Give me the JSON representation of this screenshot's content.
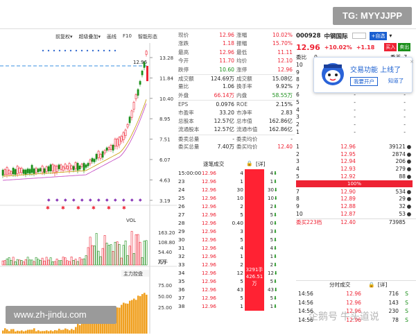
{
  "watermark_top": "TG: MYYJJPP",
  "watermark_bottom": "www.zh-jindu.com",
  "watermark_right": "企鹅号 牛头道说",
  "toolbar": {
    "items": [
      "前复权▾",
      "超级叠加▾",
      "画线",
      "F10",
      "智能形态"
    ]
  },
  "price_axis": [
    "13.28",
    "11.84",
    "10.40",
    "8.95",
    "7.51",
    "6.07",
    "4.63",
    "3.19"
  ],
  "current_price_tag": "12.96",
  "vol_label": "VOL",
  "vol_axis": [
    "163.20",
    "108.80",
    "54.40",
    "万手"
  ],
  "vol_unit": "X万",
  "fund_label": "主力控盘",
  "fund_axis": [
    "75.00",
    "50.00",
    "25.00"
  ],
  "quote": {
    "rows": [
      [
        "现价",
        "12.96",
        "涨幅",
        "10.02%"
      ],
      [
        "涨跌",
        "1.18",
        "振幅",
        "15.70%"
      ],
      [
        "最高",
        "12.96",
        "最低",
        "11.11"
      ],
      [
        "今开",
        "11.70",
        "均价",
        "12.10"
      ],
      [
        "跌停",
        "10.60",
        "涨停",
        "12.96"
      ],
      [
        "成交额",
        "124.69万",
        "成交额",
        "15.08亿"
      ],
      [
        "量比",
        "1.06",
        "换手率",
        "9.92%"
      ],
      [
        "外盘",
        "66.14万",
        "内盘",
        "58.55万"
      ],
      [
        "EPS",
        "0.0976",
        "ROE",
        "2.15%"
      ],
      [
        "市盈率",
        "33.20",
        "市净率",
        "2.83"
      ],
      [
        "总股本",
        "12.57亿",
        "总市值",
        "162.86亿"
      ],
      [
        "流通股本",
        "12.57亿",
        "流通市值",
        "162.86亿"
      ],
      [
        "委卖总量",
        "-",
        "委卖均价",
        "-"
      ],
      [
        "委买总量",
        "7.40万",
        "委买均价",
        "12.40"
      ]
    ]
  },
  "ticks_header": {
    "title": "逐笔成交",
    "lock": "🔒",
    "detail": "[详]"
  },
  "ticks": [
    [
      "15:00:00",
      "12.96",
      "4 S",
      "4"
    ],
    [
      "23",
      "12.96",
      "1 S",
      "1"
    ],
    [
      "24",
      "12.96",
      "30 S",
      "30"
    ],
    [
      "25",
      "12.96",
      "10 S",
      "10"
    ],
    [
      "26",
      "12.96",
      "2 S",
      "2"
    ],
    [
      "27",
      "12.96",
      "5 S",
      "5"
    ],
    [
      "28",
      "12.96",
      "0.40 S",
      "0"
    ],
    [
      "29",
      "12.96",
      "3 S",
      "3"
    ],
    [
      "30",
      "12.96",
      "5 S",
      "5"
    ],
    [
      "31",
      "12.96",
      "4 S",
      "4"
    ],
    [
      "32",
      "12.96",
      "1 S",
      "1"
    ],
    [
      "33",
      "12.96",
      "2 S",
      "2"
    ],
    [
      "34",
      "12.96",
      "12 S",
      "12"
    ],
    [
      "35",
      "12.96",
      "5 S",
      "5"
    ],
    [
      "36",
      "12.96",
      "43 S",
      "43"
    ],
    [
      "37",
      "12.96",
      "5 S",
      "5"
    ],
    [
      "38",
      "12.96",
      "1 S",
      "1"
    ]
  ],
  "ticks_summary": {
    "hands": "3291手",
    "amount": "426.51万"
  },
  "stock": {
    "code": "000928",
    "name": "中钢国际",
    "price": "12.96",
    "change_pct": "+10.02%",
    "change": "+1.18",
    "add_watch": "+自选",
    "buy": "买入",
    "sell": "卖出",
    "weibi_label": "委比",
    "weibi_value": "0",
    "weicha_label": "委差",
    "weicha_value": "7"
  },
  "order_book": {
    "sell_levels": [
      "10",
      "9",
      "8",
      "7",
      "6",
      "5",
      "4",
      "3",
      "2",
      "1"
    ],
    "pct_bar": "100%",
    "buy": [
      [
        "1",
        "12.96",
        "39121"
      ],
      [
        "2",
        "12.95",
        "2874"
      ],
      [
        "3",
        "12.94",
        "206"
      ],
      [
        "4",
        "12.93",
        "279"
      ],
      [
        "5",
        "12.92",
        "88"
      ],
      [
        "6",
        "12.91",
        "106"
      ],
      [
        "7",
        "12.90",
        "534"
      ],
      [
        "8",
        "12.89",
        "29"
      ],
      [
        "9",
        "12.88",
        "32"
      ],
      [
        "10",
        "12.87",
        "53"
      ]
    ],
    "buy_total_label": "委买223档",
    "buy_total_price": "12.40",
    "buy_total_volume": "73985"
  },
  "trades_header": {
    "title": "分时成交",
    "detail": "[详]"
  },
  "trades": [
    [
      "14:56",
      "12.96",
      "716",
      "S"
    ],
    [
      "14:56",
      "12.96",
      "143",
      "S"
    ],
    [
      "14:56",
      "12.96",
      "230",
      "S"
    ],
    [
      "14:56",
      "12.96",
      "78",
      "S"
    ]
  ],
  "popup": {
    "title": "交易功能 上线了",
    "btn_open": "我要开户",
    "btn_know": "知道了"
  },
  "colors": {
    "up": "#e23333",
    "down": "#1a8f1a",
    "accent": "#1a5fd0"
  }
}
